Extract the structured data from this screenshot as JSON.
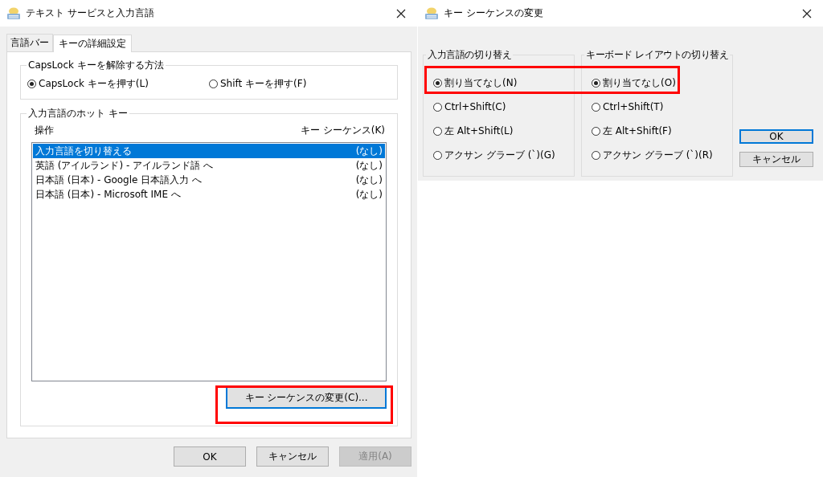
{
  "main_window": {
    "title": "テキスト サービスと入力言語",
    "tabs": [
      {
        "label": "言語バー",
        "selected": false
      },
      {
        "label": "キーの詳細設定",
        "selected": true
      }
    ],
    "capslock_group": {
      "title": "CapsLock キーを解除する方法",
      "options": [
        {
          "label": "CapsLock キーを押す(L)",
          "selected": true
        },
        {
          "label": "Shift キーを押す(F)",
          "selected": false
        }
      ]
    },
    "hotkey_group": {
      "title": "入力言語のホット キー",
      "columns": [
        "操作",
        "キー シーケンス(K)"
      ],
      "rows": [
        {
          "action": "入力言語を切り替える",
          "sequence": "(なし)",
          "selected": true
        },
        {
          "action": "英語 (アイルランド) - アイルランド語 へ",
          "sequence": "(なし)",
          "selected": false
        },
        {
          "action": "日本語 (日本) - Google 日本語入力 へ",
          "sequence": "(なし)",
          "selected": false
        },
        {
          "action": "日本語 (日本) - Microsoft IME へ",
          "sequence": "(なし)",
          "selected": false
        }
      ],
      "change_button": {
        "label": "キー シーケンスの変更(C)...",
        "focused": true
      }
    },
    "buttons": [
      {
        "label": "OK",
        "disabled": false
      },
      {
        "label": "キャンセル",
        "disabled": false
      },
      {
        "label": "適用(A)",
        "disabled": true
      }
    ]
  },
  "dialog": {
    "title": "キー シーケンスの変更",
    "groups": [
      {
        "title": "入力言語の切り替え",
        "options": [
          {
            "label": "割り当てなし(N)",
            "selected": true
          },
          {
            "label": "Ctrl+Shift(C)",
            "selected": false
          },
          {
            "label": "左 Alt+Shift(L)",
            "selected": false
          },
          {
            "label": "アクサン グラーブ (`)(G)",
            "selected": false
          }
        ]
      },
      {
        "title": "キーボード レイアウトの切り替え",
        "options": [
          {
            "label": "割り当てなし(O)",
            "selected": true
          },
          {
            "label": "Ctrl+Shift(T)",
            "selected": false
          },
          {
            "label": "左 Alt+Shift(F)",
            "selected": false
          },
          {
            "label": "アクサン グラーブ (`)(R)",
            "selected": false
          }
        ]
      }
    ],
    "buttons": [
      {
        "label": "OK",
        "focused": true
      },
      {
        "label": "キャンセル",
        "focused": false
      }
    ]
  }
}
